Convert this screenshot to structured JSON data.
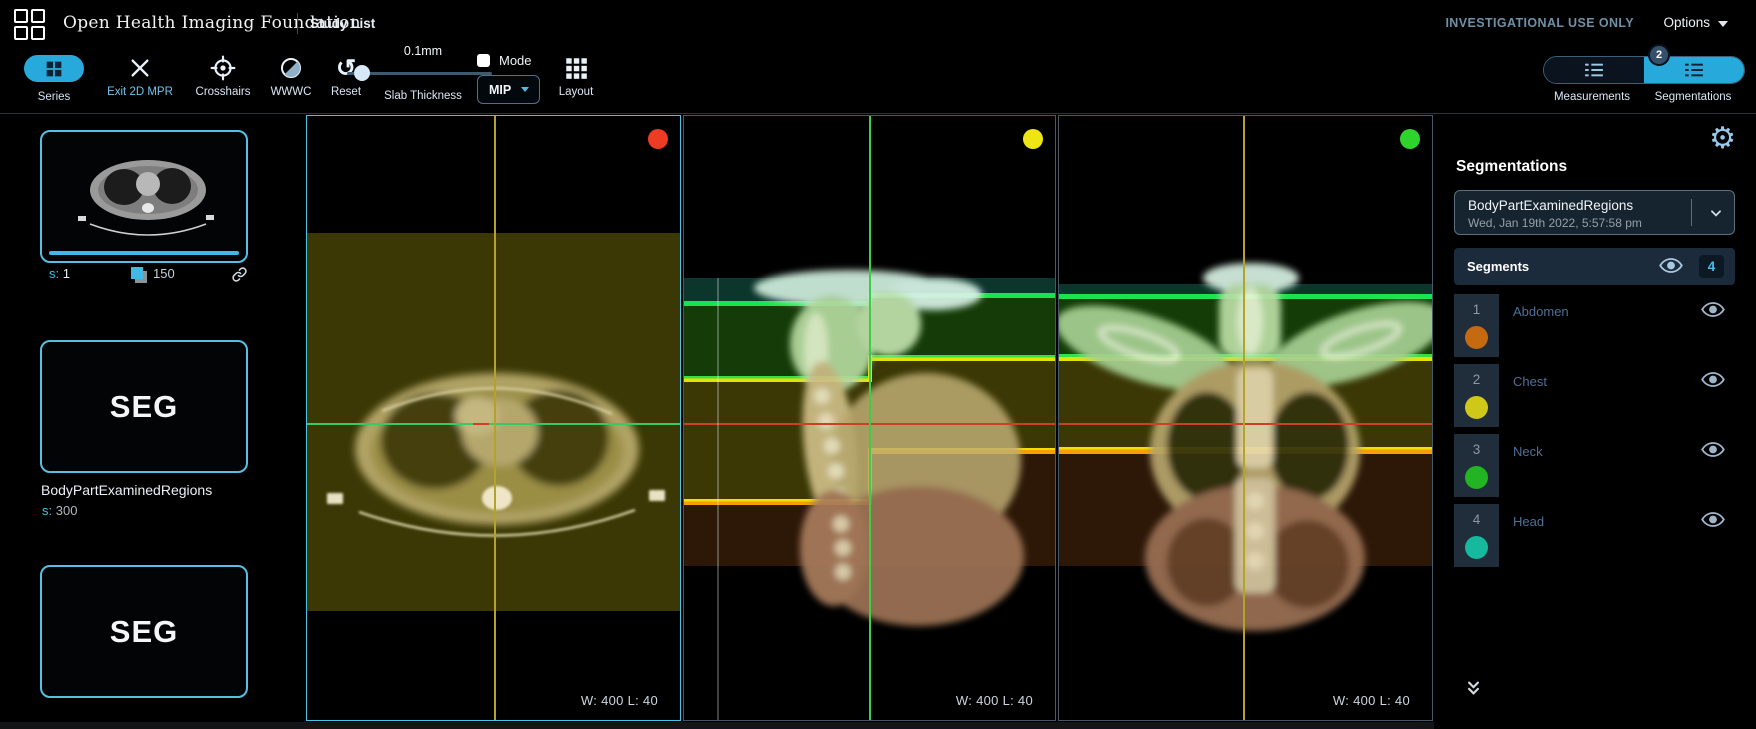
{
  "header": {
    "title": "Open Health Imaging Foundation",
    "study_list": "Study List",
    "investigational": "INVESTIGATIONAL USE ONLY",
    "options": "Options"
  },
  "toolbar": {
    "series": "Series",
    "exit_mpr": "Exit 2D MPR",
    "crosshairs": "Crosshairs",
    "wwwc": "WWWC",
    "reset": "Reset",
    "slab_value": "0.1mm",
    "slab_label": "Slab Thickness",
    "mode": "Mode",
    "mip": "MIP",
    "layout": "Layout",
    "measurements": "Measurements",
    "segmentations": "Segmentations",
    "badge": "2"
  },
  "sidebar": {
    "thumb1": {
      "series_prefix": "s:",
      "series_number": "1",
      "instances": "150"
    },
    "thumb2": {
      "modality": "SEG",
      "label": "BodyPartExaminedRegions",
      "series_prefix": "s:",
      "series_number": "300"
    },
    "thumb3": {
      "modality": "SEG"
    }
  },
  "viewports": [
    {
      "orientation": "axial",
      "color": "#ee3b23",
      "wl": "W: 400 L: 40"
    },
    {
      "orientation": "sagittal",
      "color": "#efe512",
      "wl": "W: 400 L: 40"
    },
    {
      "orientation": "coronal",
      "color": "#2ed32e",
      "wl": "W: 400 L: 40"
    }
  ],
  "panel": {
    "title": "Segmentations",
    "active_segmentation": "BodyPartExaminedRegions",
    "timestamp": "Wed, Jan 19th 2022, 5:57:58 pm",
    "segments_label": "Segments",
    "segments_count": "4",
    "segments": [
      {
        "index": "1",
        "label": "Abdomen",
        "color": "#c56a10"
      },
      {
        "index": "2",
        "label": "Chest",
        "color": "#d0c818"
      },
      {
        "index": "3",
        "label": "Neck",
        "color": "#22b422"
      },
      {
        "index": "4",
        "label": "Head",
        "color": "#16b89e"
      }
    ]
  },
  "colors": {
    "accent": "#28a9dc",
    "active_viewport_border": "#49c3e6"
  }
}
